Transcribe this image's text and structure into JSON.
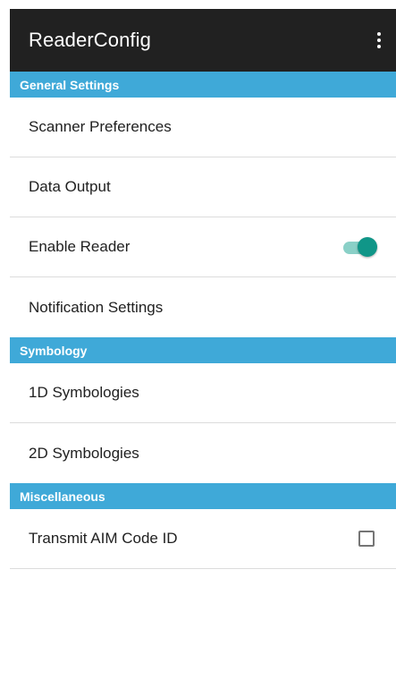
{
  "app_bar": {
    "title": "ReaderConfig",
    "menu_icon": "more-vert-icon"
  },
  "colors": {
    "app_bar_bg": "#212121",
    "section_header_bg": "#3fa9d8",
    "toggle_accent": "#109688"
  },
  "sections": [
    {
      "header": "General Settings",
      "items": [
        {
          "label": "Scanner Preferences"
        },
        {
          "label": "Data Output"
        },
        {
          "label": "Enable Reader",
          "control": "toggle",
          "checked": true
        },
        {
          "label": "Notification Settings"
        }
      ]
    },
    {
      "header": "Symbology",
      "items": [
        {
          "label": "1D Symbologies"
        },
        {
          "label": "2D Symbologies"
        }
      ]
    },
    {
      "header": "Miscellaneous",
      "items": [
        {
          "label": "Transmit AIM Code ID",
          "control": "checkbox",
          "checked": false
        }
      ]
    }
  ]
}
